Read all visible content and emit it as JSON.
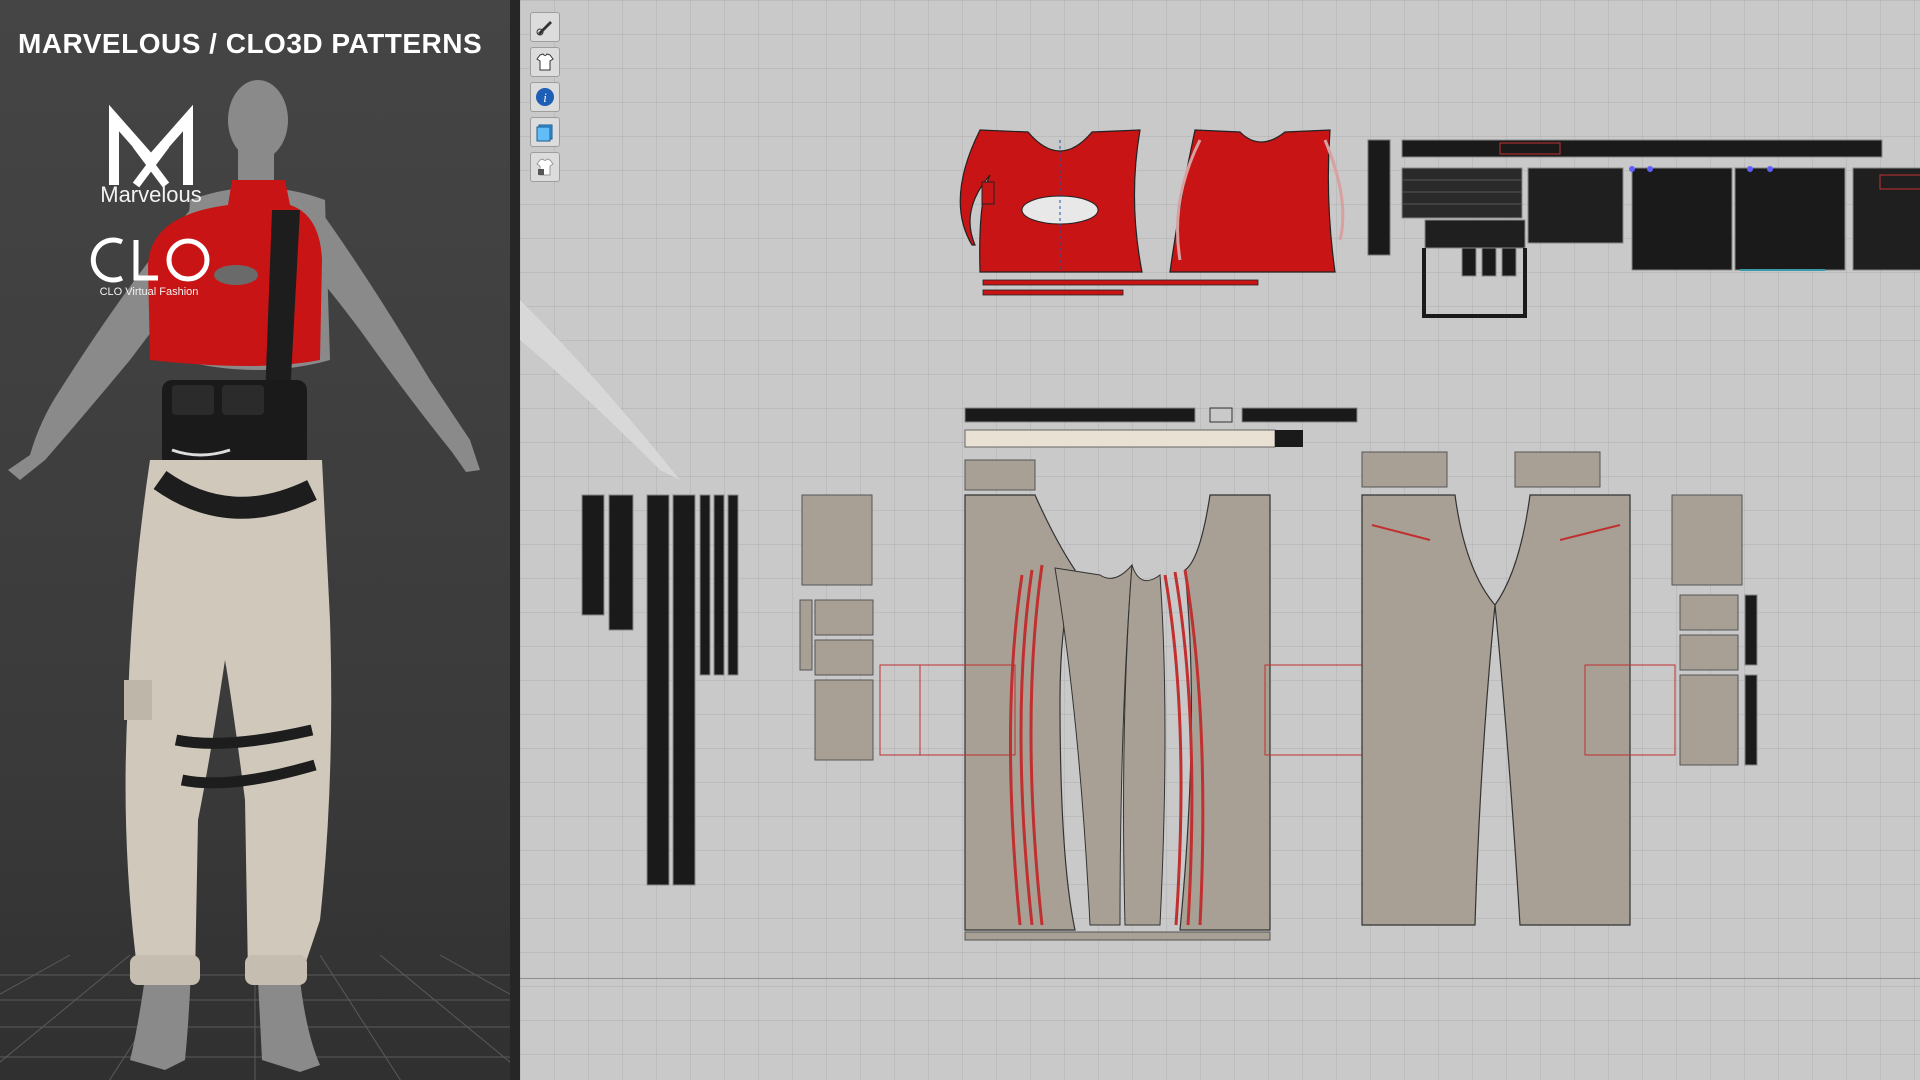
{
  "header": {
    "title": "MARVELOUS / CLO3D PATTERNS"
  },
  "logos": {
    "marvelous_label": "Marvelous",
    "clo_wordmark": "CLO",
    "clo_subtitle": "CLO Virtual Fashion"
  },
  "toolbar": {
    "tools": [
      {
        "icon": "brush-visibility-icon"
      },
      {
        "icon": "garment-visibility-icon"
      },
      {
        "icon": "info-icon"
      },
      {
        "icon": "texture-icon"
      },
      {
        "icon": "lock-garment-icon"
      }
    ]
  },
  "colors": {
    "top_fabric": "#c81414",
    "strap_fabric": "#1a1a1a",
    "pants_fabric": "#a8a095",
    "accent_red": "#d02020",
    "canvas_bg": "#c9c9c9"
  }
}
